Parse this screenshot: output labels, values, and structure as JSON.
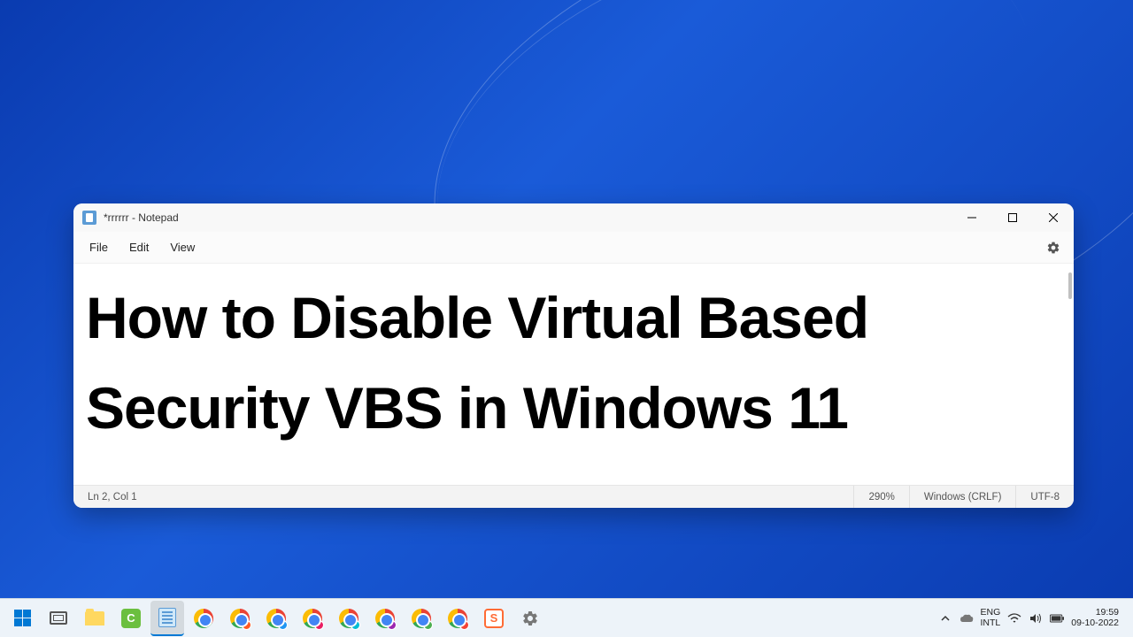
{
  "window": {
    "title": "*rrrrrr - Notepad"
  },
  "menu": {
    "file": "File",
    "edit": "Edit",
    "view": "View"
  },
  "editor": {
    "content": "How to Disable Virtual Based Security VBS in Windows 11"
  },
  "status": {
    "position": "Ln 2, Col 1",
    "zoom": "290%",
    "line_ending": "Windows (CRLF)",
    "encoding": "UTF-8"
  },
  "taskbar": {
    "language_top": "ENG",
    "language_bottom": "INTL",
    "time": "19:59",
    "date": "09-10-2022"
  }
}
